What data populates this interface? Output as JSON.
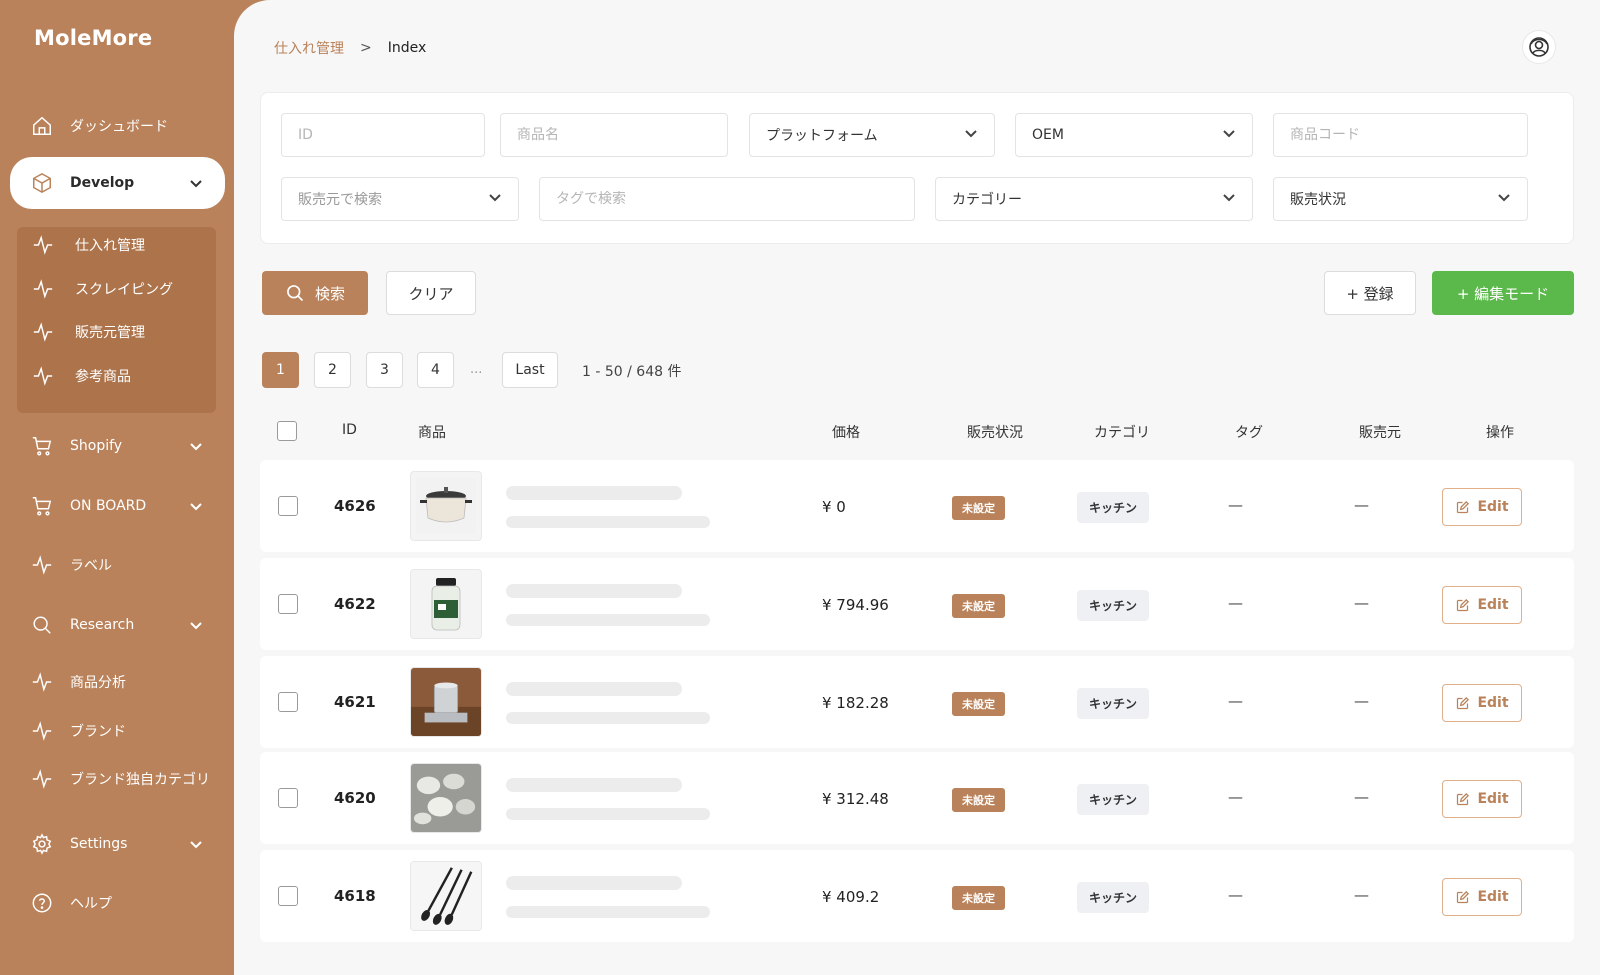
{
  "app": {
    "name": "MoleMore"
  },
  "sidebar": {
    "items": [
      {
        "label": "ダッシュボード"
      },
      {
        "label": "Develop"
      },
      {
        "label": "Shopify"
      },
      {
        "label": "ON BOARD"
      },
      {
        "label": "ラベル"
      },
      {
        "label": "Research"
      },
      {
        "label": "商品分析"
      },
      {
        "label": "ブランド"
      },
      {
        "label": "ブランド独自カテゴリ"
      },
      {
        "label": "Settings"
      },
      {
        "label": "ヘルプ"
      }
    ],
    "submenu": [
      {
        "label": "仕入れ管理"
      },
      {
        "label": "スクレイピング"
      },
      {
        "label": "販売元管理"
      },
      {
        "label": "参考商品"
      }
    ]
  },
  "breadcrumb": {
    "parent": "仕入れ管理",
    "separator": ">",
    "current": "Index"
  },
  "filters": {
    "id_placeholder": "ID",
    "name_placeholder": "商品名",
    "platform": "プラットフォーム",
    "oem": "OEM",
    "code_placeholder": "商品コード",
    "seller": "販売元で検索",
    "tag_placeholder": "タグで検索",
    "category": "カテゴリー",
    "sales_status": "販売状況"
  },
  "actions": {
    "search": "検索",
    "clear": "クリア",
    "register": "+ 登録",
    "edit_mode": "+ 編集モード"
  },
  "pagination": {
    "pages": [
      "1",
      "2",
      "3",
      "4"
    ],
    "ellipsis": "...",
    "last": "Last",
    "count": "1 - 50 / 648 件"
  },
  "table": {
    "headers": {
      "id": "ID",
      "product": "商品",
      "price": "価格",
      "status": "販売状況",
      "category": "カテゴリ",
      "tag": "タグ",
      "seller": "販売元",
      "action": "操作"
    },
    "rows": [
      {
        "id": "4626",
        "price": "¥ 0",
        "status": "未設定",
        "category": "キッチン",
        "tag": "—",
        "seller": "—",
        "edit": "Edit"
      },
      {
        "id": "4622",
        "price": "¥ 794.96",
        "status": "未設定",
        "category": "キッチン",
        "tag": "—",
        "seller": "—",
        "edit": "Edit"
      },
      {
        "id": "4621",
        "price": "¥ 182.28",
        "status": "未設定",
        "category": "キッチン",
        "tag": "—",
        "seller": "—",
        "edit": "Edit"
      },
      {
        "id": "4620",
        "price": "¥ 312.48",
        "status": "未設定",
        "category": "キッチン",
        "tag": "—",
        "seller": "—",
        "edit": "Edit"
      },
      {
        "id": "4618",
        "price": "¥ 409.2",
        "status": "未設定",
        "category": "キッチン",
        "tag": "—",
        "seller": "—",
        "edit": "Edit"
      }
    ]
  },
  "colors": {
    "brand": "#b9825a",
    "green": "#5bb84a",
    "background": "#f7f7f8"
  }
}
